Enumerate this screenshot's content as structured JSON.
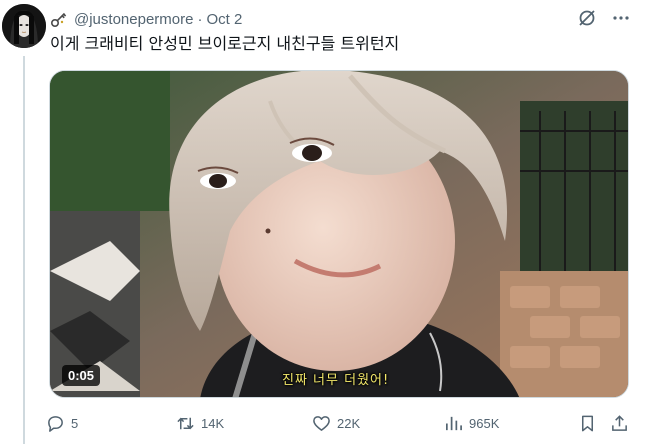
{
  "tweet": {
    "handle": "@justonepermore",
    "separator": "·",
    "date": "Oct 2",
    "text": "이게 크래비티 안성민 브이로근지 내친구들 트위턴지"
  },
  "media": {
    "timestamp": "0:05",
    "subtitle": "진짜 너무 더웠어!"
  },
  "actions": {
    "reply_count": "5",
    "retweet_count": "14K",
    "like_count": "22K",
    "view_count": "965K"
  },
  "icons": {
    "header_icon": "key-icon",
    "top_right": [
      "grok-icon",
      "more-icon"
    ],
    "bottom": [
      "reply-icon",
      "retweet-icon",
      "like-icon",
      "views-icon",
      "bookmark-icon",
      "share-icon"
    ]
  },
  "colors": {
    "text_primary": "#0f1419",
    "text_secondary": "#536471",
    "border": "#cfd9de",
    "subtitle": "#f3e86a"
  }
}
